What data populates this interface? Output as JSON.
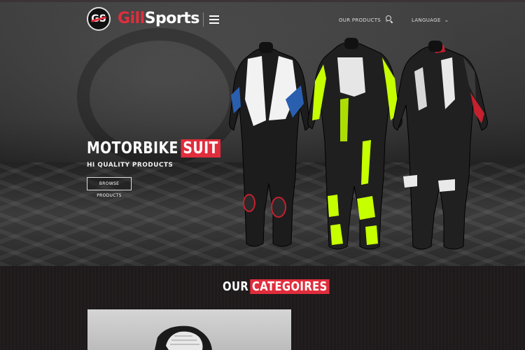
{
  "brand": {
    "logo_mark": "GS",
    "name_part1": "Gill",
    "name_part2": "Sports",
    "accent_color": "#e12d3c"
  },
  "nav": {
    "menu_icon": "hamburger-menu-icon",
    "products_label": "OUR PRODUCTS",
    "search_icon": "search-icon",
    "language_label": "LANGUAGE",
    "chevron_icon": "chevron-down-icon"
  },
  "hero": {
    "title_main": "MOTORBIKE",
    "title_accent": "SUIT",
    "subtitle": "HI QUALITY PRODUCTS",
    "button_label": "BROWSE PRODUCTS",
    "suit_colors": [
      "#3a7bd5",
      "#c6ff00",
      "#e12d3c"
    ]
  },
  "categories": {
    "title_main": "OUR",
    "title_accent": "CATEGOIRES"
  }
}
